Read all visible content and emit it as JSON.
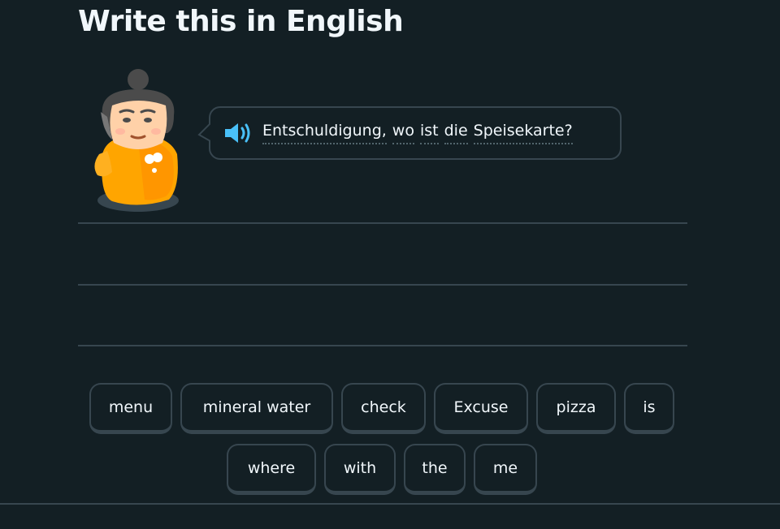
{
  "header": {
    "title": "Write this in English"
  },
  "prompt": {
    "speaker_icon": "speaker-icon",
    "sentence_words": [
      "Entschuldigung,",
      "wo",
      "ist",
      "die",
      "Speisekarte?"
    ]
  },
  "word_bank": {
    "row1": [
      "menu",
      "mineral water",
      "check",
      "Excuse",
      "pizza",
      "is"
    ],
    "row2": [
      "where",
      "with",
      "the",
      "me"
    ]
  },
  "colors": {
    "background": "#131f24",
    "border": "#37464f",
    "text": "#f1f7fb",
    "speaker_blue": "#49c0f8",
    "character_orange": "#ffa500"
  }
}
